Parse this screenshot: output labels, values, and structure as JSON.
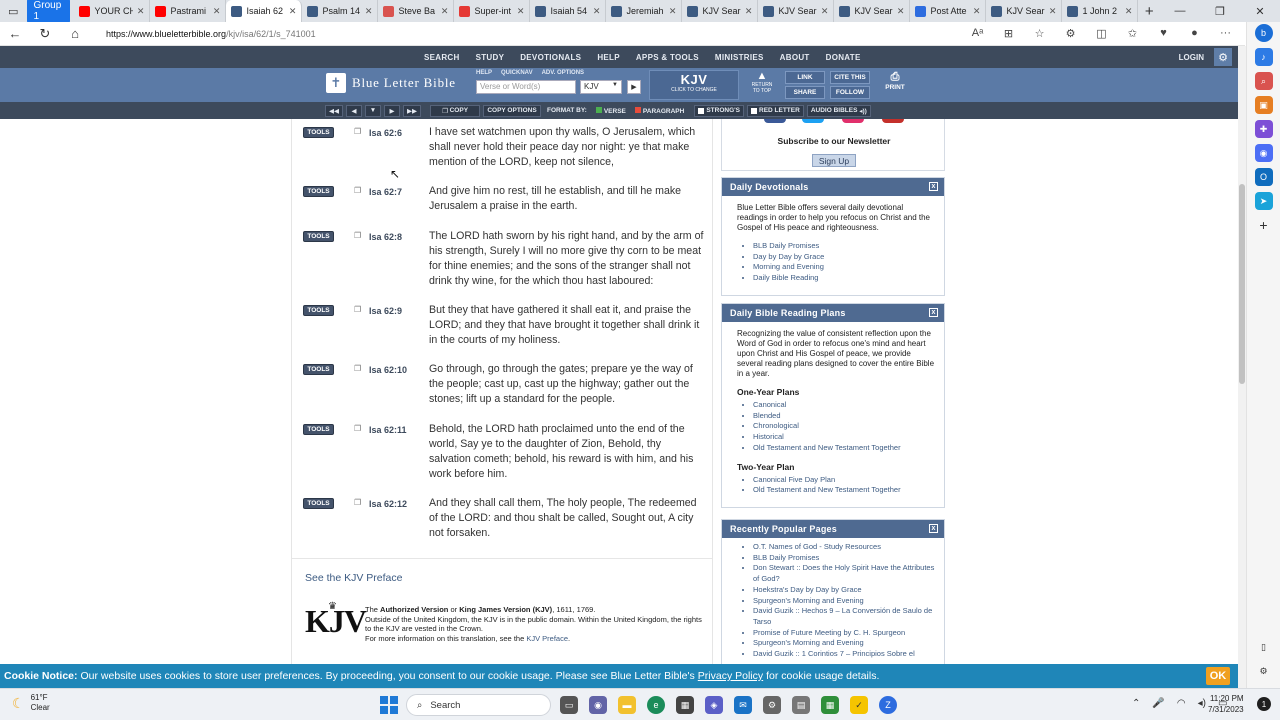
{
  "browser": {
    "group_label": "Group 1",
    "tabs": [
      {
        "title": "YOUR CH",
        "icon": "youtube-icon",
        "color": "#ff0000",
        "active": false
      },
      {
        "title": "Pastrami",
        "icon": "youtube-icon",
        "color": "#ff0000",
        "active": false
      },
      {
        "title": "Isaiah 62",
        "icon": "blb-icon",
        "color": "#3d5b82",
        "active": true
      },
      {
        "title": "Psalm 14",
        "icon": "blb-icon",
        "color": "#3d5b82",
        "active": false
      },
      {
        "title": "Steve Ba",
        "icon": "site-icon",
        "color": "#d9534f",
        "active": false
      },
      {
        "title": "Super-int",
        "icon": "chat-icon",
        "color": "#e53935",
        "active": false
      },
      {
        "title": "Isaiah 54",
        "icon": "blb-icon",
        "color": "#3d5b82",
        "active": false
      },
      {
        "title": "Jeremiah",
        "icon": "blb-icon",
        "color": "#3d5b82",
        "active": false
      },
      {
        "title": "KJV Sear",
        "icon": "blb-icon",
        "color": "#3d5b82",
        "active": false
      },
      {
        "title": "KJV Sear",
        "icon": "blb-icon",
        "color": "#3d5b82",
        "active": false
      },
      {
        "title": "KJV Sear",
        "icon": "blb-icon",
        "color": "#3d5b82",
        "active": false
      },
      {
        "title": "Post Atte",
        "icon": "z-icon",
        "color": "#2d6cdf",
        "active": false
      },
      {
        "title": "KJV Sear",
        "icon": "blb-icon",
        "color": "#3d5b82",
        "active": false
      },
      {
        "title": "1 John 2",
        "icon": "blb-icon",
        "color": "#3d5b82",
        "active": false
      }
    ],
    "url_host": "https://www.blueletterbible.org",
    "url_path": "/kjv/isa/62/1/s_741001"
  },
  "blb": {
    "topnav": [
      "SEARCH",
      "STUDY",
      "DEVOTIONALS",
      "HELP",
      "APPS & TOOLS",
      "MINISTRIES",
      "ABOUT",
      "DONATE"
    ],
    "login": "LOGIN",
    "logo_text": "Blue Letter Bible",
    "minilinks": [
      "HELP",
      "QUICKNAV",
      "ADV. OPTIONS"
    ],
    "search_placeholder": "Verse or Word(s)",
    "version": "KJV",
    "kjv_big": "KJV",
    "kjv_small": "CLICK TO CHANGE",
    "return_top": "RETURN TO TOP",
    "link": "LINK",
    "cite": "CITE THIS",
    "share": "SHARE",
    "follow": "FOLLOW",
    "print": "PRINT",
    "copy": "COPY",
    "copy_options": "COPY OPTIONS",
    "format_by": "FORMAT BY:",
    "verse": "VERSE",
    "paragraph": "PARAGRAPH",
    "strongs": "STRONG'S",
    "red_letter": "RED LETTER",
    "audio": "AUDIO BIBLES"
  },
  "verses": [
    {
      "ref": "Isa 62:6",
      "text": "I have set watchmen upon thy walls, O Jerusalem, which shall never hold their peace day nor night: ye that make mention of the LORD, keep not silence,"
    },
    {
      "ref": "Isa 62:7",
      "text": "And give him no rest, till he establish, and till he make Jerusalem a praise in the earth."
    },
    {
      "ref": "Isa 62:8",
      "text": "The LORD hath sworn by his right hand, and by the arm of his strength, Surely I will no more give thy corn to be meat for thine enemies; and the sons of the stranger shall not drink thy wine, for the which thou hast laboured:"
    },
    {
      "ref": "Isa 62:9",
      "text": "But they that have gathered it shall eat it, and praise the LORD; and they that have brought it together shall drink it in the courts of my holiness."
    },
    {
      "ref": "Isa 62:10",
      "text": "Go through, go through the gates; prepare ye the way of the people; cast up, cast up the highway; gather out the stones; lift up a standard for the people."
    },
    {
      "ref": "Isa 62:11",
      "text": "Behold, the LORD hath proclaimed unto the end of the world, Say ye to the daughter of Zion, Behold, thy salvation cometh; behold, his reward is with him, and his work before him."
    },
    {
      "ref": "Isa 62:12",
      "text": "And they shall call them, The holy people, The redeemed of the LORD: and thou shalt be called, Sought out, A city not forsaken."
    }
  ],
  "tools_label": "TOOLS",
  "preface": {
    "link": "See the KJV Preface",
    "logo": "KJV",
    "av": "Authorized Version",
    "or": "or",
    "kjv_name": "King James Version (KJV)",
    "years": ", 1611, 1769.",
    "the": "The",
    "line2": "Outside of the United Kingdom, the KJV is in the public domain. Within the United Kingdom, the rights to the KJV are vested in the Crown.",
    "line3": "For more information on this translation, see the",
    "line3_link": "KJV Preface",
    "line3_end": "."
  },
  "sidebar": {
    "newsletter": "Subscribe to our Newsletter",
    "signup": "Sign Up",
    "devotionals": {
      "title": "Daily Devotionals",
      "desc": "Blue Letter Bible offers several daily devotional readings in order to help you refocus on Christ and the Gospel of His peace and righteousness.",
      "items": [
        "BLB Daily Promises",
        "Day by Day by Grace",
        "Morning and Evening",
        "Daily Bible Reading"
      ]
    },
    "plans": {
      "title": "Daily Bible Reading Plans",
      "desc": "Recognizing the value of consistent reflection upon the Word of God in order to refocus one's mind and heart upon Christ and His Gospel of peace, we provide several reading plans designed to cover the entire Bible in a year.",
      "one_year": "One-Year Plans",
      "one_items": [
        "Canonical",
        "Blended",
        "Chronological",
        "Historical",
        "Old Testament and New Testament Together"
      ],
      "two_year": "Two-Year Plan",
      "two_items": [
        "Canonical Five Day Plan",
        "Old Testament and New Testament Together"
      ]
    },
    "popular": {
      "title": "Recently Popular Pages",
      "items": [
        "O.T. Names of God - Study Resources",
        "BLB Daily Promises",
        "Don Stewart :: Does the Holy Spirit Have the Attributes of God?",
        "Hoekstra's Day by Day by Grace",
        "Spurgeon's Morning and Evening",
        "David Guzik :: Hechos 9 – La Conversión de Saulo de Tarso",
        "Promise of Future Meeting by C. H. Spurgeon",
        "Spurgeon's Morning and Evening",
        "David Guzik :: 1 Corintios 7 – Principios Sobre el"
      ]
    }
  },
  "cookie": {
    "label": "Cookie Notice:",
    "text": "Our website uses cookies to store user preferences. By proceeding, you consent to our cookie usage. Please see Blue Letter Bible's",
    "policy": "Privacy Policy",
    "end": "for cookie usage details.",
    "ok": "OK"
  },
  "taskbar": {
    "temp": "61°F",
    "cond": "Clear",
    "search": "Search",
    "time": "11:20 PM",
    "date": "7/31/2023",
    "notif": "1"
  }
}
